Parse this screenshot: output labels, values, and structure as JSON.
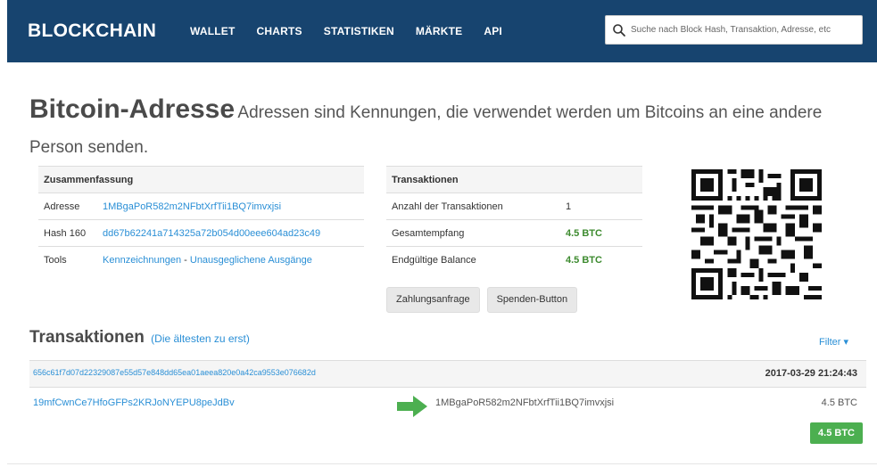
{
  "navbar": {
    "brand": "BLOCKCHAIN",
    "links": [
      "WALLET",
      "CHARTS",
      "STATISTIKEN",
      "MÄRKTE",
      "API"
    ],
    "search_placeholder": "Suche nach Block Hash, Transaktion, Adresse, etc",
    "search_icon": "search-icon",
    "background": "#17446f"
  },
  "heading": {
    "title": "Bitcoin-Adresse",
    "subtitle": "Adressen sind Kennungen, die verwendet werden um Bitcoins an eine andere Person senden."
  },
  "summary": {
    "header": "Zusammenfassung",
    "address_label": "Adresse",
    "address_value": "1MBgaPoR582m2NFbtXrfTii1BQ7imvxjsi",
    "hash160_label": "Hash 160",
    "hash160_value": "dd67b62241a714325a72b054d00eee604ad23c49",
    "tools_label": "Tools",
    "tools_link1": "Kennzeichnungen",
    "tools_sep": "-",
    "tools_link2": "Unausgeglichene Ausgänge"
  },
  "transactions_box": {
    "header": "Transaktionen",
    "count_label": "Anzahl der Transaktionen",
    "count_value": "1",
    "received_label": "Gesamtempfang",
    "received_value": "4.5 BTC",
    "balance_label": "Endgültige Balance",
    "balance_value": "4.5 BTC"
  },
  "buttons": {
    "payment_request": "Zahlungsanfrage",
    "donate_button": "Spenden-Button"
  },
  "tx_list": {
    "title": "Transaktionen",
    "order": "(Die ältesten zu erst)",
    "filter": "Filter ▾",
    "items": [
      {
        "hash": "656c61f7d07d22329087e55d57e848dd65ea01aeea820e0a42ca9553e076682d",
        "time": "2017-03-29 21:24:43",
        "from": "19mfCwnCe7HfoGFPs2KRJoNYEPU8peJdBv",
        "to": "1MBgaPoR582m2NFbtXrfTii1BQ7imvxjsi",
        "amount": "4.5 BTC",
        "total": "4.5 BTC"
      }
    ]
  },
  "colors": {
    "link": "#2a8fd6",
    "green": "#3c8a2e",
    "badge": "#4caf50"
  }
}
